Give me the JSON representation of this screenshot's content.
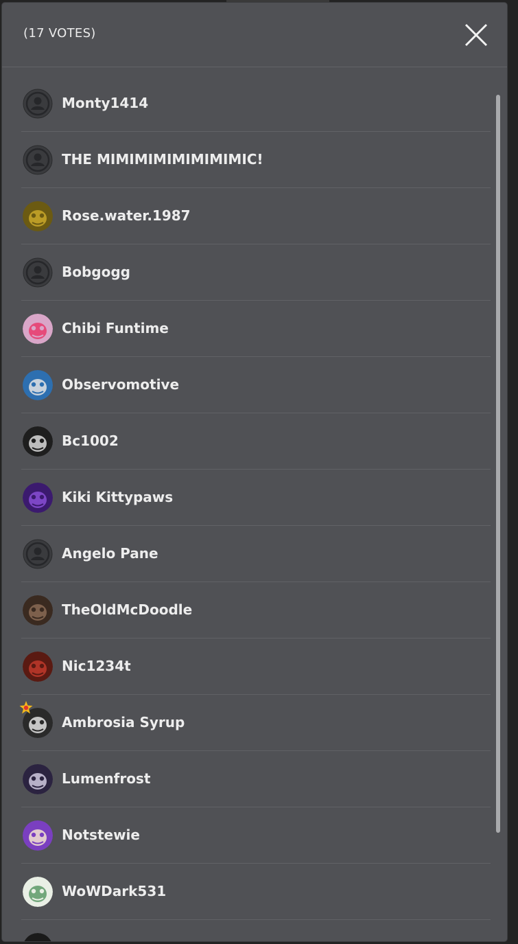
{
  "modal": {
    "title": "(17 VOTES)",
    "close_icon": "close-icon"
  },
  "voters": [
    {
      "name": "Monty1414",
      "avatar": "default-user-icon",
      "colors": [
        "#3b3c3f",
        "#2e2f31"
      ]
    },
    {
      "name": "THE MIMIMIMIMIMIMIMIC!",
      "avatar": "default-user-icon",
      "colors": [
        "#3b3c3f",
        "#2e2f31"
      ]
    },
    {
      "name": "Rose.water.1987",
      "avatar": "yellow-mask-avatar",
      "colors": [
        "#6b5a12",
        "#c9a82a"
      ]
    },
    {
      "name": "Bobgogg",
      "avatar": "default-user-icon",
      "colors": [
        "#3b3c3f",
        "#2e2f31"
      ]
    },
    {
      "name": "Chibi Funtime",
      "avatar": "pink-character-avatar",
      "colors": [
        "#d9a6c8",
        "#e83a6c"
      ]
    },
    {
      "name": "Observomotive",
      "avatar": "train-avatar",
      "colors": [
        "#2d6fb0",
        "#e4e4e4"
      ]
    },
    {
      "name": "Bc1002",
      "avatar": "dark-character-avatar",
      "colors": [
        "#1e1e1e",
        "#d9d9d9"
      ]
    },
    {
      "name": "Kiki Kittypaws",
      "avatar": "purple-character-avatar",
      "colors": [
        "#3b1a6e",
        "#8a4fd6"
      ]
    },
    {
      "name": "Angelo Pane",
      "avatar": "default-user-icon",
      "colors": [
        "#3b3c3f",
        "#2e2f31"
      ]
    },
    {
      "name": "TheOldMcDoodle",
      "avatar": "portrait-avatar",
      "colors": [
        "#3a2a20",
        "#8a6a55"
      ]
    },
    {
      "name": "Nic1234t",
      "avatar": "red-character-avatar",
      "colors": [
        "#5a1a12",
        "#c0392b"
      ]
    },
    {
      "name": "Ambrosia Syrup",
      "avatar": "monochrome-avatar",
      "colors": [
        "#2a2a2a",
        "#e0e0e0"
      ],
      "badge": "star-badge-icon"
    },
    {
      "name": "Lumenfrost",
      "avatar": "dark-purple-avatar",
      "colors": [
        "#2b2340",
        "#d0c9e0"
      ]
    },
    {
      "name": "Notstewie",
      "avatar": "purple-stripe-avatar",
      "colors": [
        "#7a3fc0",
        "#f3e3d0"
      ]
    },
    {
      "name": "WoWDark531",
      "avatar": "green-pattern-avatar",
      "colors": [
        "#e9efe5",
        "#5d9a68"
      ]
    },
    {
      "name": "",
      "avatar": "partial-avatar",
      "colors": [
        "#1a1a1a",
        "#dddddd"
      ]
    }
  ]
}
